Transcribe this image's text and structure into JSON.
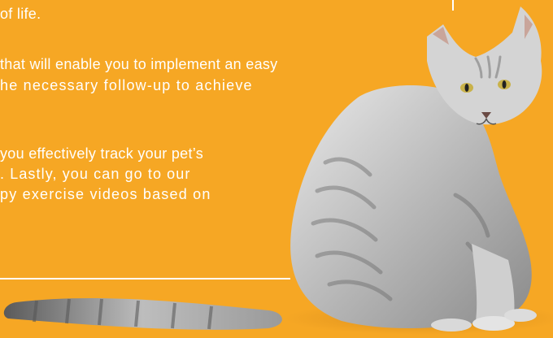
{
  "text": {
    "line1": "of life.",
    "line2": "that will enable you to implement an easy",
    "line3": "he necessary follow-up to achieve",
    "line4": "you effectively track your pet’s",
    "line5": ". Lastly, you can go to our",
    "line6": "py exercise videos based on"
  },
  "colors": {
    "background": "#F6A724",
    "text": "#FFFFFF"
  },
  "image": {
    "subject": "grey tabby cat sitting, looking back over shoulder"
  }
}
